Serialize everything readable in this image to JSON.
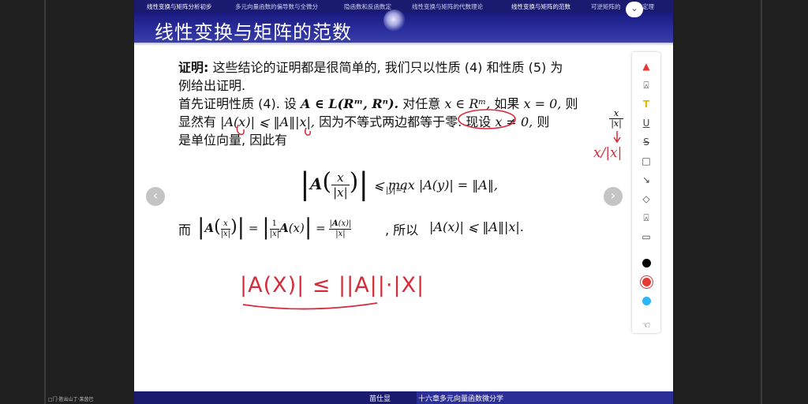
{
  "left_caption": "□门·胜出山丁·莱茵巴",
  "nav": {
    "items": [
      "线性变换与矩阵分析初步",
      "多元向量函数的偏导数与全微分",
      "隐函数和反函数定",
      "线性变换与矩阵的代数理论",
      "线性变换与矩阵的范数",
      "可逆矩阵的",
      "定理"
    ],
    "active_index": [
      0,
      4
    ]
  },
  "slide_title": "线性变换与矩阵的范数",
  "proof": {
    "line1_label": "证明:",
    "line1_text": "这些结论的证明都是很简单的, 我们只以性质 (4) 和性质 (5) 为",
    "line2": "例给出证明.",
    "line3_a": "首先证明性质 (4). 设",
    "line3_math": "A ∈ L(Rᵐ, Rⁿ).",
    "line3_b": "对任意",
    "line3_math2": "x ∈ Rᵐ,",
    "line3_c": "如果",
    "line3_math3": "x = 0,",
    "line3_d": "则",
    "line4_a": "显然有",
    "line4_math": "|A(x)| ⩽ ‖A‖|x|,",
    "line4_b": "因为不等式两边都等于零. 现设",
    "line4_math2": "x ≠ 0,",
    "line4_c": "则",
    "line5": "是单位向量, 因此有",
    "display_eq_rhs": "⩽ max |A(y)| = ‖A‖,",
    "display_eq_sub": "|y|=1",
    "line7_a": "而",
    "line7_b": ", 所以",
    "line7_math": "|A(x)| ⩽ ‖A‖|x|."
  },
  "handwriting": {
    "note": "|A(X)| ≤ ||A||·|X|",
    "side_note": "x/|x|"
  },
  "footer": {
    "author": "苗仕显",
    "course": "十六章多元向量函数微分学"
  },
  "toolbar": {
    "tools": [
      "pen-icon",
      "highlighter-icon",
      "text-icon",
      "underline-icon",
      "strikethrough-icon",
      "rectangle-icon",
      "arrow-icon",
      "eraser-icon",
      "marker-icon",
      "comment-icon"
    ],
    "colors": [
      "#000000",
      "#e53935",
      "#29b6f6"
    ],
    "hand": "hand-icon"
  },
  "nav_arrows": {
    "prev": "‹",
    "next": "›"
  },
  "colors": {
    "nav_bg": "#1a1a6e",
    "title_bg": "#2b2f9e",
    "ink_red": "#d62b3a"
  }
}
